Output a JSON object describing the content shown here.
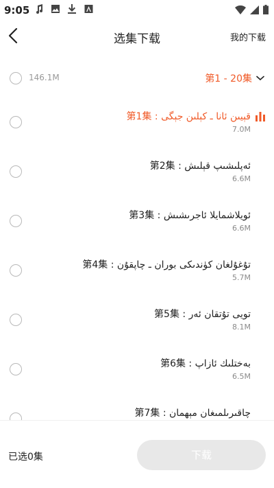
{
  "status_bar": {
    "time": "9:05",
    "left_icons": [
      "music-icon",
      "image-icon",
      "download-icon",
      "store-icon"
    ],
    "right_icons": [
      "wifi-icon",
      "signal-icon",
      "battery-icon"
    ]
  },
  "nav": {
    "title": "选集下载",
    "my_download": "我的下载",
    "back_icon": "chevron-left-icon"
  },
  "select_all": {
    "total_size": "146.1M",
    "range_label": "第1 - 20集",
    "range_icon": "chevron-down-icon"
  },
  "colors": {
    "accent": "#f05a28",
    "button_disabled": "#e8e8e8",
    "radio_border": "#b8b8b8"
  },
  "episodes": [
    {
      "title": "第1集 : قېيىن ئانا ـ كېلىن جېگى",
      "size": "7.0M",
      "playing": true
    },
    {
      "title": "第2集 : ئەپلىشىپ قېلىش",
      "size": "6.6M",
      "playing": false
    },
    {
      "title": "第3集 : ئويلاشمايلا ئاجرىشىش",
      "size": "6.6M",
      "playing": false
    },
    {
      "title": "第4集 : تۇغۇلغان كۈندىكى بوران ـ چاپقۇن",
      "size": "5.7M",
      "playing": false
    },
    {
      "title": "第5集 : تويى تۇتقان ئەر",
      "size": "8.1M",
      "playing": false
    },
    {
      "title": "第6集 : بەختلىك ئازاپ",
      "size": "6.5M",
      "playing": false
    },
    {
      "title": "第7集 : چاقىرىلمىغان مېھمان",
      "size": "",
      "playing": false
    }
  ],
  "bottom": {
    "selected_count": "已选0集",
    "download_label": "下载"
  }
}
